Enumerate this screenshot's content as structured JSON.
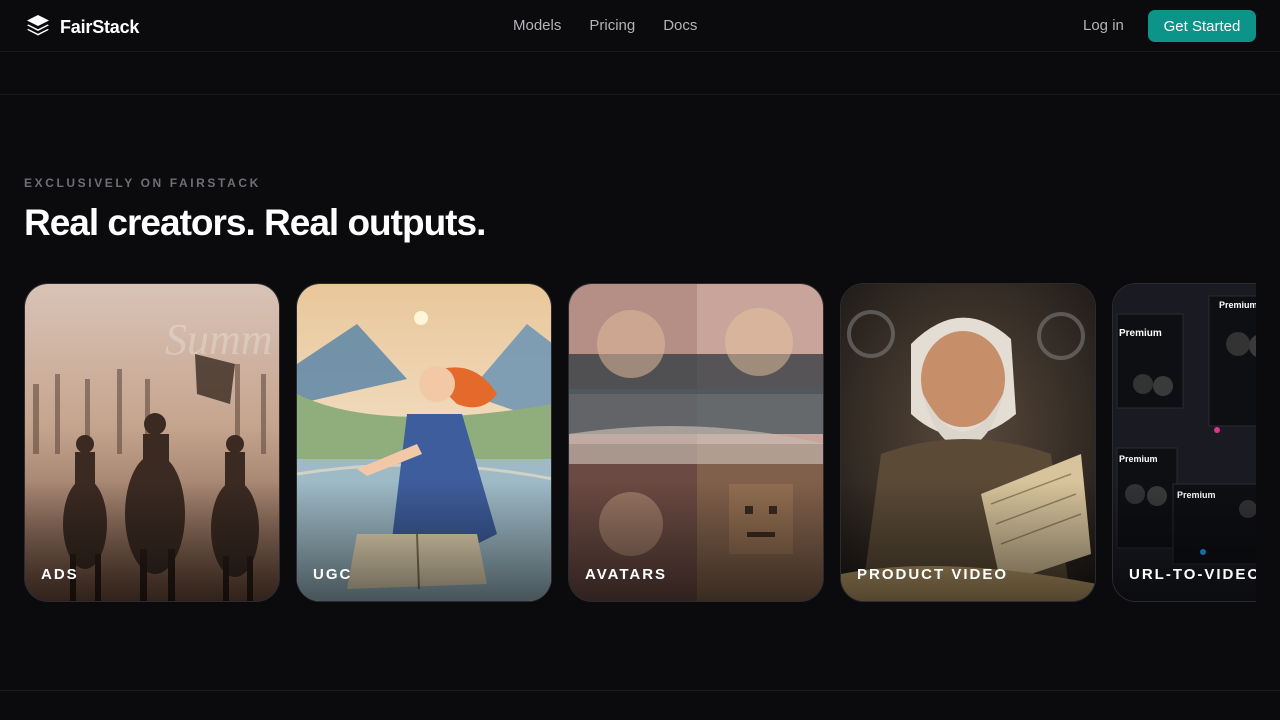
{
  "brand": {
    "name": "FairStack",
    "icon": "layers-icon"
  },
  "nav": {
    "items": [
      "Models",
      "Pricing",
      "Docs"
    ]
  },
  "auth": {
    "login_label": "Log in",
    "cta_label": "Get Started"
  },
  "section": {
    "eyebrow": "EXCLUSIVELY ON FAIRSTACK",
    "headline": "Real creators. Real outputs."
  },
  "cards": [
    {
      "label": "ADS"
    },
    {
      "label": "UGC"
    },
    {
      "label": "AVATARS"
    },
    {
      "label": "PRODUCT VIDEO"
    },
    {
      "label": "URL-TO-VIDEO"
    }
  ],
  "colors": {
    "accent": "#0d9488",
    "background": "#0b0b0d"
  }
}
